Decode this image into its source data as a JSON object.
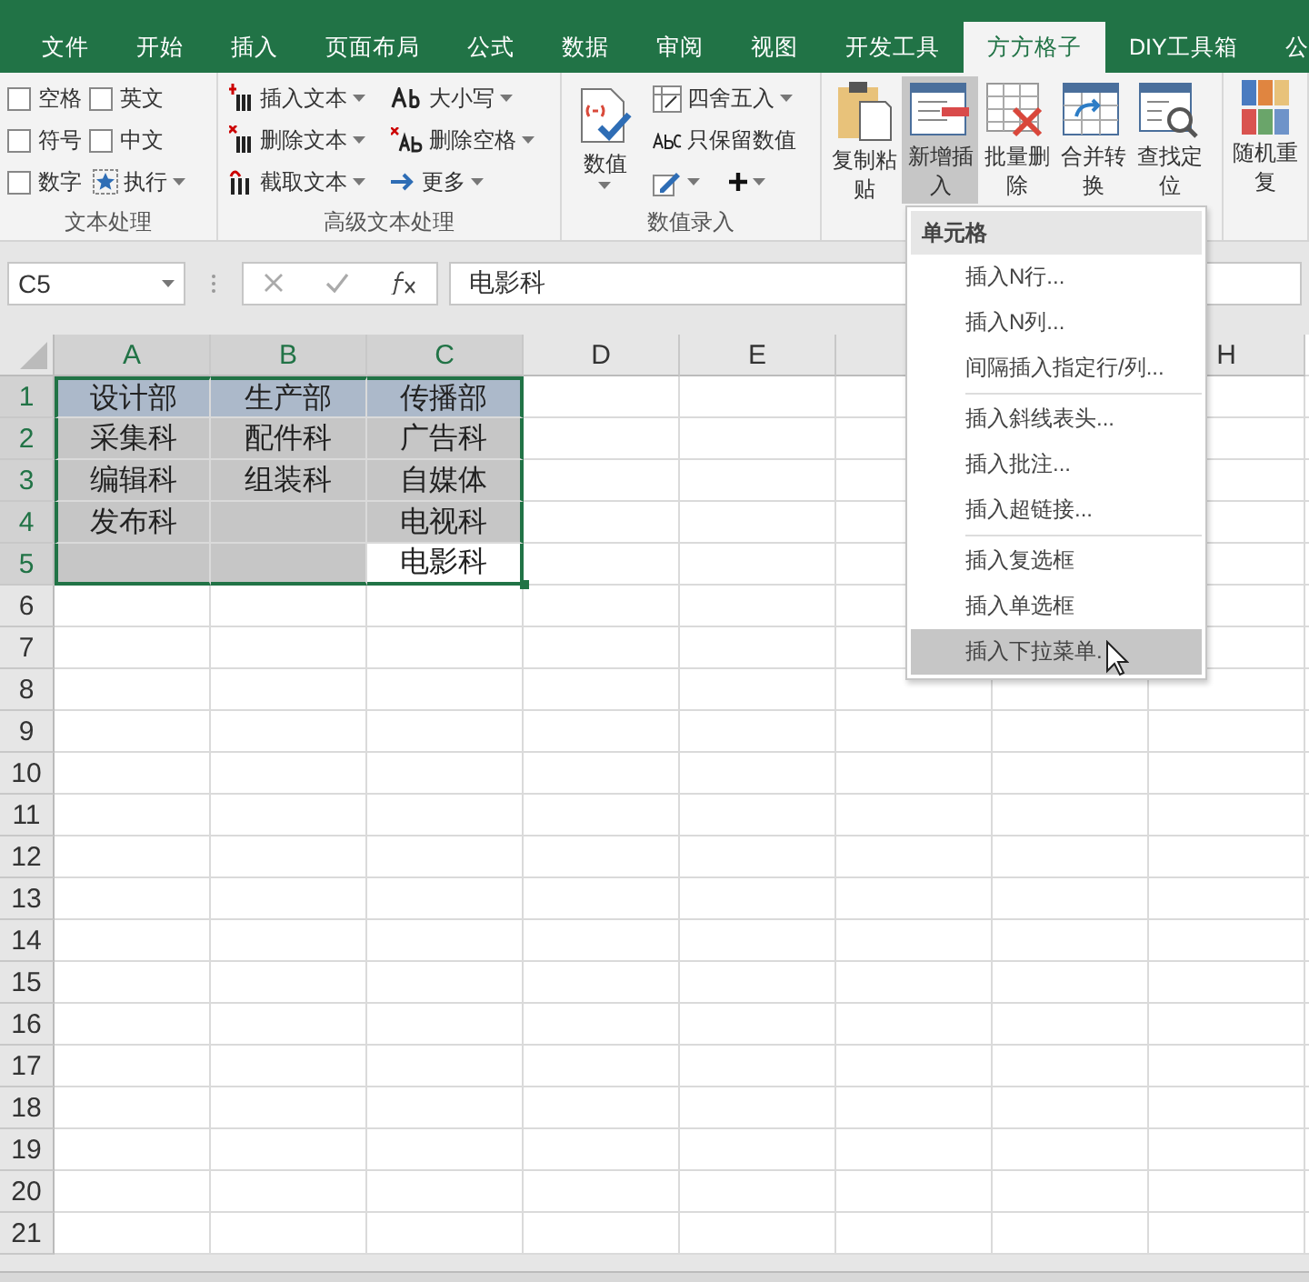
{
  "tabs": [
    {
      "label": "文件",
      "selected": false
    },
    {
      "label": "开始",
      "selected": false
    },
    {
      "label": "插入",
      "selected": false
    },
    {
      "label": "页面布局",
      "selected": false
    },
    {
      "label": "公式",
      "selected": false
    },
    {
      "label": "数据",
      "selected": false
    },
    {
      "label": "审阅",
      "selected": false
    },
    {
      "label": "视图",
      "selected": false
    },
    {
      "label": "开发工具",
      "selected": false
    },
    {
      "label": "方方格子",
      "selected": true
    },
    {
      "label": "DIY工具箱",
      "selected": false
    },
    {
      "label": "公",
      "selected": false
    }
  ],
  "ribbon": {
    "text_group": {
      "label": "文本处理",
      "checkboxes": [
        {
          "label": "空格",
          "checked": false
        },
        {
          "label": "英文",
          "checked": false
        },
        {
          "label": "符号",
          "checked": false
        },
        {
          "label": "中文",
          "checked": false
        },
        {
          "label": "数字",
          "checked": false
        }
      ],
      "run_button": "执行"
    },
    "advanced_group": {
      "label": "高级文本处理",
      "buttons": [
        {
          "label": "插入文本"
        },
        {
          "label": "大小写"
        },
        {
          "label": "删除文本"
        },
        {
          "label": "删除空格"
        },
        {
          "label": "截取文本"
        },
        {
          "label": "更多"
        }
      ]
    },
    "number_group": {
      "label": "数值录入",
      "big_button": "数值",
      "round_button": "四舍五入",
      "keep_button": "只保留数值"
    },
    "tools": [
      {
        "label": "复制粘贴",
        "selected": false
      },
      {
        "label": "新增插入",
        "selected": true
      },
      {
        "label": "批量删除",
        "selected": false
      },
      {
        "label": "合并转换",
        "selected": false
      },
      {
        "label": "查找定位",
        "selected": false
      }
    ],
    "random_button": "随机重复"
  },
  "formula_bar": {
    "name_box": "C5",
    "value": "电影科"
  },
  "sheet": {
    "columns": [
      {
        "label": "A",
        "selected": true
      },
      {
        "label": "B",
        "selected": true
      },
      {
        "label": "C",
        "selected": true
      },
      {
        "label": "D",
        "selected": false
      },
      {
        "label": "E",
        "selected": false
      },
      {
        "label": "H",
        "selected": false
      }
    ],
    "rows": [
      {
        "label": "1",
        "selected": true,
        "kind": "title",
        "cells": [
          {
            "text": "设计部",
            "selected": true
          },
          {
            "text": "生产部",
            "selected": true
          },
          {
            "text": "传播部",
            "selected": true
          }
        ]
      },
      {
        "label": "2",
        "selected": true,
        "kind": "body",
        "cells": [
          {
            "text": "采集科",
            "selected": true
          },
          {
            "text": "配件科",
            "selected": true
          },
          {
            "text": "广告科",
            "selected": true
          }
        ]
      },
      {
        "label": "3",
        "selected": true,
        "kind": "body",
        "cells": [
          {
            "text": "编辑科",
            "selected": true
          },
          {
            "text": "组装科",
            "selected": true
          },
          {
            "text": "自媒体",
            "selected": true
          }
        ]
      },
      {
        "label": "4",
        "selected": true,
        "kind": "body",
        "cells": [
          {
            "text": "发布科",
            "selected": true
          },
          {
            "selected": true
          },
          {
            "text": "电视科",
            "selected": true
          }
        ]
      },
      {
        "label": "5",
        "selected": true,
        "kind": "body",
        "cells": [
          {
            "selected": true
          },
          {
            "selected": true
          },
          {
            "text": "电影科",
            "selected": false
          }
        ]
      },
      {
        "label": "6",
        "selected": false
      },
      {
        "label": "7",
        "selected": false
      },
      {
        "label": "8",
        "selected": false
      },
      {
        "label": "9",
        "selected": false
      },
      {
        "label": "10",
        "selected": false
      },
      {
        "label": "11",
        "selected": false
      },
      {
        "label": "12",
        "selected": false
      },
      {
        "label": "13",
        "selected": false
      },
      {
        "label": "14",
        "selected": false
      },
      {
        "label": "15",
        "selected": false
      },
      {
        "label": "16",
        "selected": false
      },
      {
        "label": "17",
        "selected": false
      },
      {
        "label": "18",
        "selected": false
      },
      {
        "label": "19",
        "selected": false
      },
      {
        "label": "20",
        "selected": false
      },
      {
        "label": "21",
        "selected": false
      }
    ]
  },
  "menu": {
    "header": "单元格",
    "sections": [
      [
        {
          "label": "插入N行...",
          "selected": false
        },
        {
          "label": "插入N列...",
          "selected": false
        },
        {
          "label": "间隔插入指定行/列...",
          "selected": false
        }
      ],
      [
        {
          "label": "插入斜线表头...",
          "selected": false
        },
        {
          "label": "插入批注...",
          "selected": false
        },
        {
          "label": "插入超链接...",
          "selected": false
        }
      ],
      [
        {
          "label": "插入复选框",
          "selected": false
        },
        {
          "label": "插入单选框",
          "selected": false
        },
        {
          "label": "插入下拉菜单.",
          "selected": true
        }
      ]
    ]
  }
}
